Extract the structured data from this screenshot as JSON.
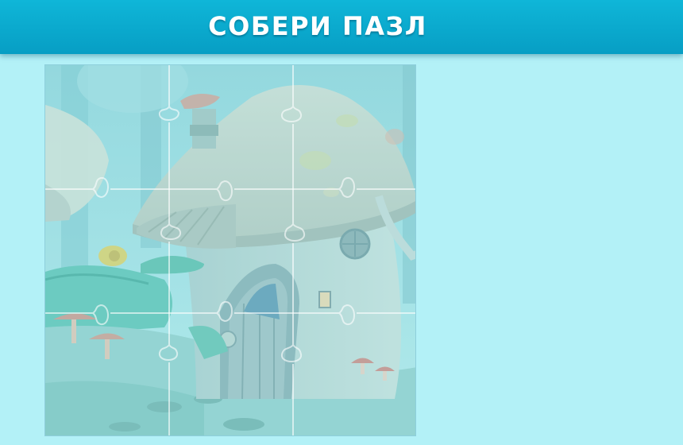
{
  "header": {
    "title": "СОБЕРИ ПАЗЛ"
  },
  "puzzle": {
    "rows": 3,
    "cols": 3,
    "image": "mushroom-house-scene",
    "placed_pieces": 0,
    "total_pieces": 9
  },
  "colors": {
    "header": "#0aa9cf",
    "background": "#b3f1f7",
    "piece_outline": "#ffffff"
  }
}
